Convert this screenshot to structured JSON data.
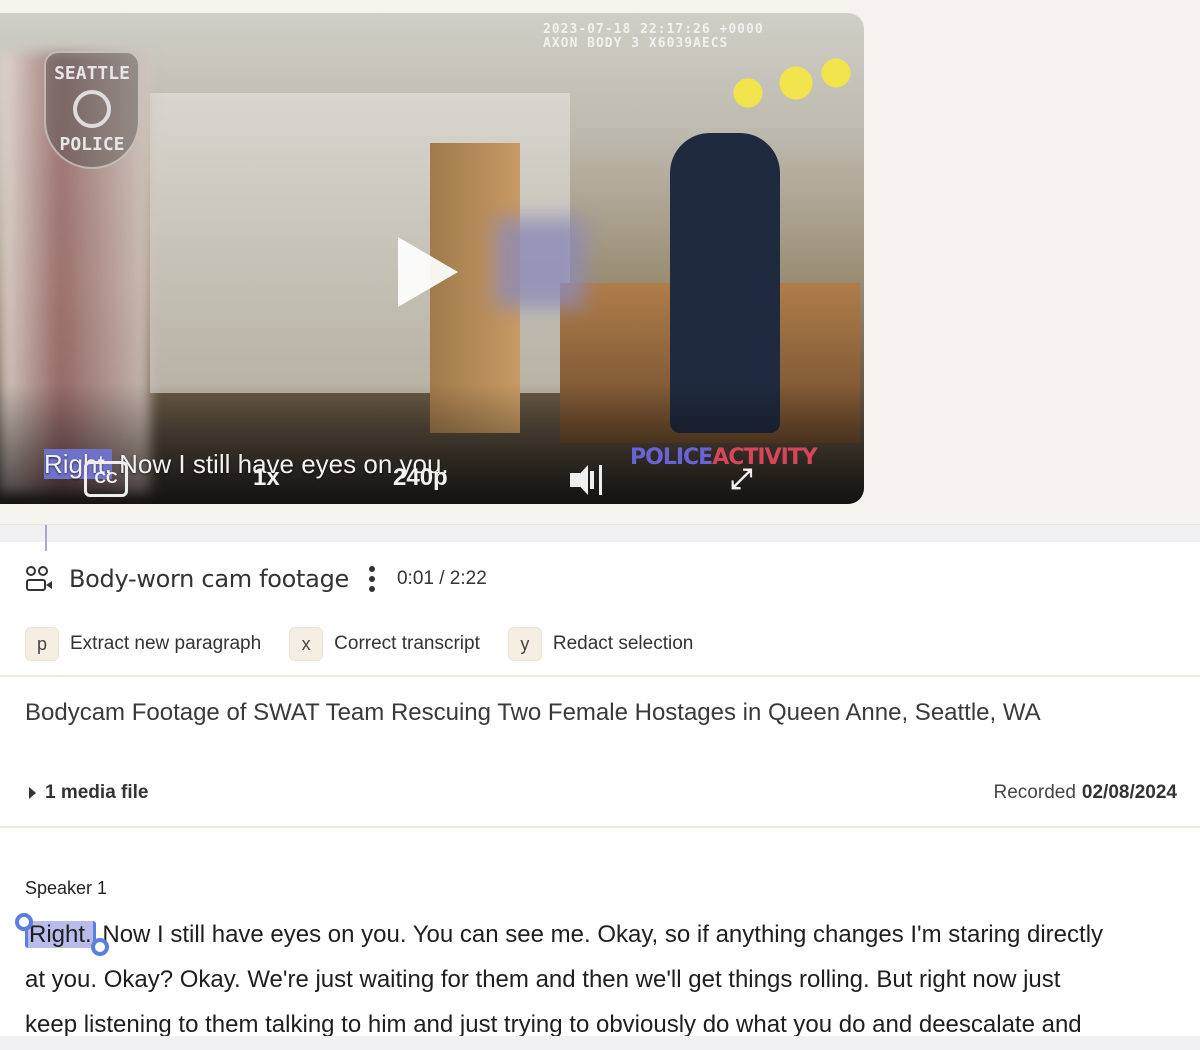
{
  "video": {
    "badge_top": "SEATTLE",
    "badge_bottom": "POLICE",
    "timestamp_line1": "2023-07-18 22:17:26 +0000",
    "timestamp_line2": "AXON BODY 3 X6039AECS",
    "caption_highlight": "Right.",
    "caption_rest": " Now I still have eyes on you.",
    "cc_label": "CC",
    "speed": "1x",
    "quality": "240p",
    "watermark_a": "POLICE",
    "watermark_b": "ACTIVITY",
    "fullscreen_glyph": "⤢"
  },
  "media": {
    "title": "Body-worn cam footage",
    "current_time": "0:01",
    "duration": "2:22",
    "time_display": "0:01 / 2:22"
  },
  "actions": [
    {
      "key": "p",
      "label": "Extract new paragraph"
    },
    {
      "key": "x",
      "label": "Correct transcript"
    },
    {
      "key": "y",
      "label": "Redact selection"
    }
  ],
  "description": "Bodycam Footage of SWAT Team Rescuing Two Female Hostages in Queen Anne, Seattle, WA",
  "media_files_label": "1 media file",
  "recorded_label": "Recorded",
  "recorded_date": "02/08/2024",
  "transcript": {
    "speaker": "Speaker 1",
    "selected_word": "Right.",
    "line1_rest": " Now I still have eyes on you. You can see me. Okay, so if anything changes I'm staring directly",
    "line2": "at you. Okay? Okay. We're just waiting for them and then we'll get things rolling. But right now just",
    "line3": "keep listening to them talking to him and just trying to obviously do what you do and deescalate and"
  }
}
